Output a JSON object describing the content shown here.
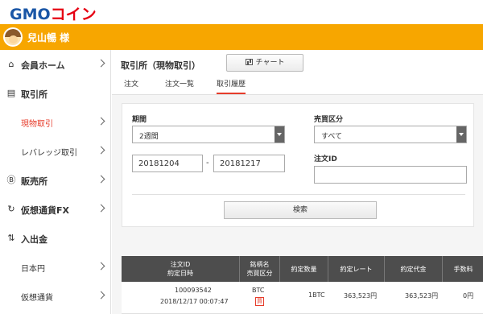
{
  "app": {
    "logo_gmo": "GMO",
    "logo_coin": "コイン",
    "username": "兒山暢 様"
  },
  "sidebar": {
    "items": [
      {
        "label": "会員ホーム",
        "icon": "home-icon",
        "glyph": "⌂"
      },
      {
        "label": "取引所",
        "icon": "exchange-icon",
        "glyph": "▤"
      },
      {
        "label": "現物取引",
        "sub": true,
        "active": true
      },
      {
        "label": "レバレッジ取引",
        "sub": true
      },
      {
        "label": "販売所",
        "icon": "bitcoin-icon",
        "glyph": "Ⓑ"
      },
      {
        "label": "仮想通貨FX",
        "icon": "fx-icon",
        "glyph": "↻"
      },
      {
        "label": "入出金",
        "icon": "deposit-icon",
        "glyph": "⇅"
      },
      {
        "label": "日本円",
        "sub": true
      },
      {
        "label": "仮想通貨",
        "sub": true
      }
    ]
  },
  "main": {
    "title": "取引所（現物取引）",
    "chart_button": "チャート",
    "tabs": [
      {
        "label": "注文"
      },
      {
        "label": "注文一覧"
      },
      {
        "label": "取引履歴",
        "active": true
      }
    ]
  },
  "filter": {
    "period_label": "期間",
    "period_value": "2週間",
    "date_from": "20181204",
    "date_to": "20181217",
    "date_sep": "-",
    "side_label": "売買区分",
    "side_value": "すべて",
    "order_id_label": "注文ID",
    "order_id_value": "",
    "search_button": "検索"
  },
  "table": {
    "headers": {
      "col1_line1": "注文ID",
      "col1_line2": "約定日時",
      "col2_line1": "銘柄名",
      "col2_line2": "売買区分",
      "col3": "約定数量",
      "col4": "約定レート",
      "col5": "約定代金",
      "col6": "手数料"
    },
    "rows": [
      {
        "order_id": "100093542",
        "datetime": "2018/12/17 00:07:47",
        "symbol": "BTC",
        "side": "買",
        "quantity": "1BTC",
        "rate": "363,523円",
        "amount": "363,523円",
        "fee": "0円"
      }
    ]
  },
  "colors": {
    "accent_orange": "#f7a600",
    "accent_red": "#e63c2b",
    "header_dark": "#4d4d4d"
  }
}
